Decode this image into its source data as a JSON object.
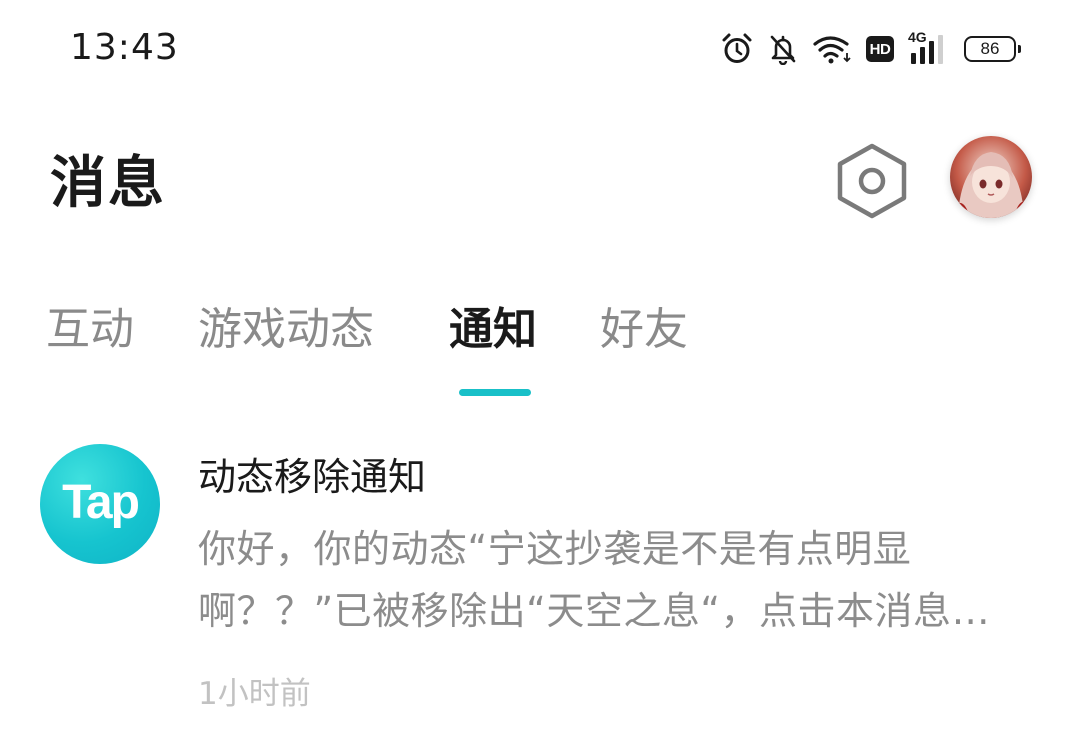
{
  "status_bar": {
    "time": "13:43",
    "network": "4G",
    "hd_label": "HD",
    "battery": "86",
    "icons": [
      "alarm-icon",
      "bell-off-icon",
      "wifi-icon",
      "hd-icon",
      "signal-icon",
      "battery-icon"
    ]
  },
  "header": {
    "title": "消息",
    "settings_icon": "settings-icon",
    "avatar_icon": "avatar"
  },
  "tabs": [
    {
      "label": "互动",
      "active": false
    },
    {
      "label": "游戏动态",
      "active": false
    },
    {
      "label": "通知",
      "active": true
    },
    {
      "label": "好友",
      "active": false
    }
  ],
  "accent_color": "#19c0c8",
  "notifications": [
    {
      "logo_text": "Tap",
      "title": "动态移除通知",
      "body": "你好，你的动态“宁这抄袭是不是有点明显啊？？”已被移除出“天空之息“，点击本消息查看详情",
      "time": "1小时前"
    }
  ]
}
